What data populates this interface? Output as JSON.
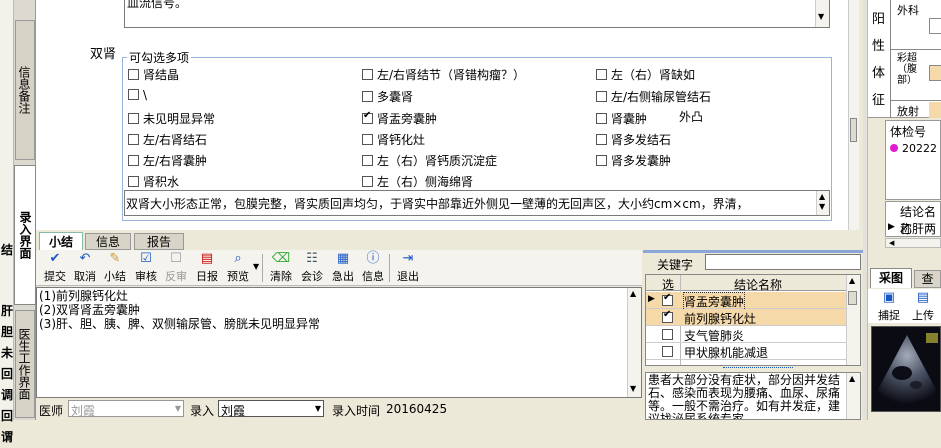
{
  "left_tabs": [
    "信息备注",
    "录入界面",
    "医生工作界面"
  ],
  "left_edge_chars": [
    "结",
    "肝",
    "胆",
    "未",
    "回",
    "调",
    "回",
    "谓"
  ],
  "upper_text": "血流信号。",
  "kidney": {
    "label": "双肾",
    "group_title": "可勾选多项",
    "options": [
      {
        "text": "肾结晶",
        "checked": false
      },
      {
        "text": "左/右肾结节（肾错构瘤？）",
        "checked": false
      },
      {
        "text": "左（右）肾缺如",
        "checked": false
      },
      {
        "text": "\\",
        "checked": false
      },
      {
        "text": "多囊肾",
        "checked": false
      },
      {
        "text": "左/右侧输尿管结石",
        "checked": false
      },
      {
        "text": "未见明显异常",
        "checked": false
      },
      {
        "text": "肾盂旁囊肿",
        "checked": true
      },
      {
        "text": "肾囊肿",
        "checked": false
      },
      {
        "text": "左/右肾结石",
        "checked": false
      },
      {
        "text": "肾钙化灶",
        "checked": false
      },
      {
        "text": "肾多发结石",
        "checked": false
      },
      {
        "text": "左/右肾囊肿",
        "checked": false
      },
      {
        "text": "左（右）肾钙质沉淀症",
        "checked": false
      },
      {
        "text": "肾多发囊肿",
        "checked": false
      },
      {
        "text": "肾积水",
        "checked": false
      },
      {
        "text": "左（右）侧海绵肾",
        "checked": false
      }
    ],
    "extra_label": "外凸",
    "desc": "双肾大小形态正常，包膜完整，肾实质回声均匀，于肾实中部靠近外侧见一壁薄的无回声区，大小约cm×cm，界清，"
  },
  "tabs": [
    "小结",
    "信息",
    "报告"
  ],
  "toolbar": [
    "提交",
    "取消",
    "小结",
    "审核",
    "反审",
    "日报",
    "预览",
    "清除",
    "会诊",
    "急出",
    "信息",
    "退出"
  ],
  "summary_lines": [
    "(1)前列腺钙化灶",
    "(2)双肾肾盂旁囊肿",
    "(3)肝、胆、胰、脾、双侧输尿管、膀胱未见明显异常"
  ],
  "bottom": {
    "doctor_label": "医师",
    "doctor_value": "刘霞",
    "entry_label": "录入",
    "entry_value": "刘霞",
    "time_label": "录入时间",
    "time_value": "20160425"
  },
  "keywords": {
    "label": "关键字",
    "col_select": "选",
    "col_name": "结论名称",
    "rows": [
      {
        "name": "肾盂旁囊肿",
        "checked": true,
        "current": true,
        "highlight": true
      },
      {
        "name": "前列腺钙化灶",
        "checked": true,
        "current": false,
        "highlight": true
      },
      {
        "name": "支气管肺炎",
        "checked": false,
        "current": false,
        "highlight": false
      },
      {
        "name": "甲状腺机能减退",
        "checked": false,
        "current": false,
        "highlight": false
      }
    ],
    "note": "患者大部分没有症状，部分因并发结石、感染而表现为腰痛、血尿、尿痛等。一般不需治疗。如有并发症，建议找泌尿系统专家"
  },
  "right": {
    "yang_chars": [
      "阳",
      "性",
      "体",
      "征"
    ],
    "waike": "外科",
    "caichao": "彩超（腹部）",
    "fangshe": "放射",
    "tijianhao_label": "体检号",
    "tijianhao_value": "20222",
    "jielun_label": "结论名称",
    "jielun_value": "乙肝两",
    "tabs": [
      "采图",
      "查"
    ],
    "capture_label": "捕捉",
    "upload_label": "上传"
  },
  "colors": {
    "highlight": "#f6d9a8",
    "selected_cell": "#f5a623",
    "bullet": "#e01ad0",
    "tab_active": "#ffffff"
  }
}
